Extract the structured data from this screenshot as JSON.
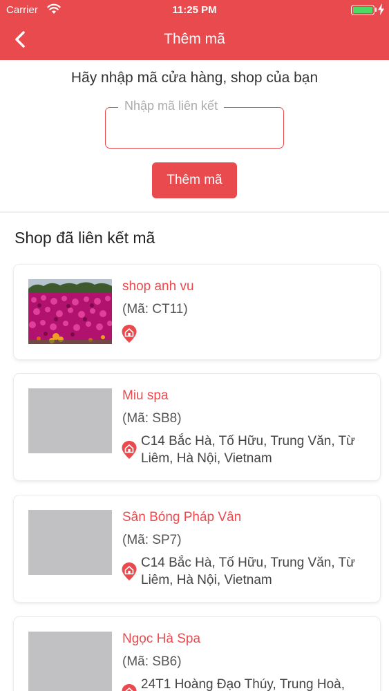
{
  "status_bar": {
    "carrier": "Carrier",
    "time": "11:25 PM"
  },
  "header": {
    "title": "Thêm mã"
  },
  "form": {
    "prompt": "Hãy nhập mã cửa hàng, shop của bạn",
    "input_label": "Nhập mã liên kết",
    "input_value": "",
    "submit_label": "Thêm mã"
  },
  "linked_shops": {
    "title": "Shop đã liên kết mã",
    "items": [
      {
        "name": "shop anh vu",
        "code": "(Mã: CT11)",
        "address": "",
        "image": "flower-photo"
      },
      {
        "name": "Miu spa",
        "code": "(Mã: SB8)",
        "address": "C14 Bắc Hà, Tố Hữu, Trung Văn, Từ Liêm, Hà Nội, Vietnam",
        "image": "placeholder"
      },
      {
        "name": "Sân Bóng Pháp Vân",
        "code": "(Mã: SP7)",
        "address": "C14 Bắc Hà, Tố Hữu, Trung Văn, Từ Liêm, Hà Nội, Vietnam",
        "image": "placeholder"
      },
      {
        "name": "Ngọc Hà Spa",
        "code": "(Mã: SB6)",
        "address": "24T1 Hoàng Đạo Thúy, Trung Hoà,",
        "image": "placeholder"
      }
    ]
  },
  "colors": {
    "accent": "#e94a4e",
    "placeholder_image": "#c1c0c3"
  },
  "icons": {
    "back": "chevron-left-icon",
    "location": "map-pin-home-icon"
  }
}
